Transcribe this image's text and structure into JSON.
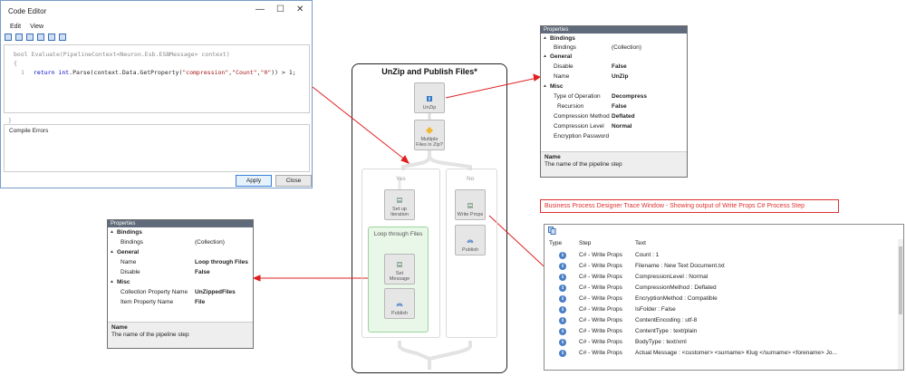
{
  "code_editor": {
    "title": "Code Editor",
    "menu": [
      "Edit",
      "View"
    ],
    "signature": "bool Evaluate(PipelineContext<Neuron.Esb.ESBMessage> context)",
    "open_brace": "{",
    "line_number": "1",
    "code_kw1": "return",
    "code_kw2": "int",
    "code_mid": ".Parse(context.Data.GetProperty(",
    "code_str1": "\"compression\"",
    "code_comma1": ",",
    "code_str2": "\"Count\"",
    "code_comma2": ",",
    "code_str3": "\"0\"",
    "code_end": ")) > 1;",
    "close_brace": "}",
    "compile_errors_label": "Compile Errors",
    "apply_label": "Apply",
    "close_label": "Close"
  },
  "designer": {
    "title": "UnZip and Publish Files*",
    "steps": {
      "unzip": "UnZip",
      "decision": "Multiple Files in Zip?",
      "set_iteration": "Set up Iteration",
      "loop_title": "Loop through Files",
      "set_message": "Set Message",
      "publish_loop": "Publish",
      "write_props": "Write Props",
      "publish_no": "Publish"
    },
    "branch_yes": "Yes",
    "branch_no": "No"
  },
  "props_right": {
    "header": "Properties",
    "categories": [
      "Bindings",
      "General",
      "Misc"
    ],
    "rows": [
      {
        "name": "Bindings",
        "value": "(Collection)",
        "bold": false
      },
      {
        "name": "Disable",
        "value": "False",
        "bold": true
      },
      {
        "name": "Name",
        "value": "UnZip",
        "bold": true
      },
      {
        "name": "Type of Operation",
        "value": "Decompress",
        "bold": true
      },
      {
        "name": "Recursion",
        "value": "False",
        "bold": true
      },
      {
        "name": "Compression Method",
        "value": "Deflated",
        "bold": true
      },
      {
        "name": "Compression Level",
        "value": "Normal",
        "bold": true
      },
      {
        "name": "Encryption Password",
        "value": "",
        "bold": false
      }
    ],
    "desc_title": "Name",
    "desc_text": "The name of the pipeline step"
  },
  "props_left": {
    "header": "Properties",
    "categories": [
      "Bindings",
      "General",
      "Misc"
    ],
    "rows": [
      {
        "name": "Bindings",
        "value": "(Collection)",
        "bold": false
      },
      {
        "name": "Name",
        "value": "Loop through Files",
        "bold": true
      },
      {
        "name": "Disable",
        "value": "False",
        "bold": true
      },
      {
        "name": "Collection Property Name",
        "value": "UnZippedFiles",
        "bold": true
      },
      {
        "name": "Item Property Name",
        "value": "File",
        "bold": true
      }
    ],
    "desc_title": "Name",
    "desc_text": "The name of the pipeline step"
  },
  "trace": {
    "caption": "Business Process Designer Trace Window - Showing output of Write Props C# Process Step",
    "columns": [
      "Type",
      "Step",
      "Text"
    ],
    "rows": [
      {
        "step": "C# - Write Props",
        "text": "Count : 1"
      },
      {
        "step": "C# - Write Props",
        "text": "Filename : New Text Document.txt"
      },
      {
        "step": "C# - Write Props",
        "text": "CompressionLevel : Normal"
      },
      {
        "step": "C# - Write Props",
        "text": "CompressionMethod : Deflated"
      },
      {
        "step": "C# - Write Props",
        "text": "EncryptionMethod : Compatible"
      },
      {
        "step": "C# - Write Props",
        "text": "IsFolder : False"
      },
      {
        "step": "C# - Write Props",
        "text": "ContentEncoding : utf-8"
      },
      {
        "step": "C# - Write Props",
        "text": "ContentType : text/plain"
      },
      {
        "step": "C# - Write Props",
        "text": "BodyType : text/xml"
      },
      {
        "step": "C# - Write Props",
        "text": "Actual Message : <customer>  <surname>   Klug  </surname>  <forename>   Jo..."
      }
    ],
    "info_glyph": "i"
  },
  "colors": {
    "arrow": "#e02020",
    "loop_green": "#9bd59b",
    "header_bar": "#5f6b7b"
  }
}
